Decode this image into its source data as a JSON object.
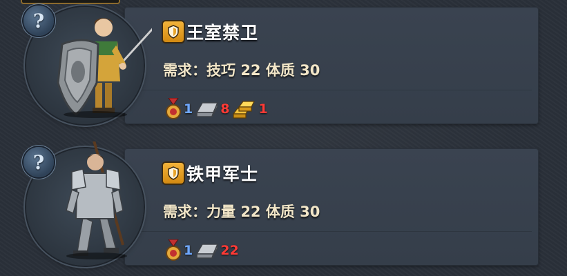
{
  "units": [
    {
      "name": "王室禁卫",
      "req_label": "需求：",
      "req_stat1": "技巧",
      "req_val1": "22",
      "req_stat2": "体质",
      "req_val2": "30",
      "cost": {
        "medal": "1",
        "iron": "8",
        "gold": "1"
      }
    },
    {
      "name": "铁甲军士",
      "req_label": "需求：",
      "req_stat1": "力量",
      "req_val1": "22",
      "req_stat2": "体质",
      "req_val2": "30",
      "cost": {
        "medal": "1",
        "iron": "22"
      }
    }
  ],
  "help_glyph": "?",
  "icons": {
    "help": "question-mark-icon",
    "class_badge": "shield-icon",
    "medal": "medal-icon",
    "iron": "iron-ingot-icon",
    "gold": "gold-bars-icon"
  },
  "colors": {
    "panel": "#3a4350",
    "background": "#2a3039",
    "badge": "#f3b33a",
    "count_blue": "#6fa8ff",
    "count_red": "#ff3a35"
  }
}
